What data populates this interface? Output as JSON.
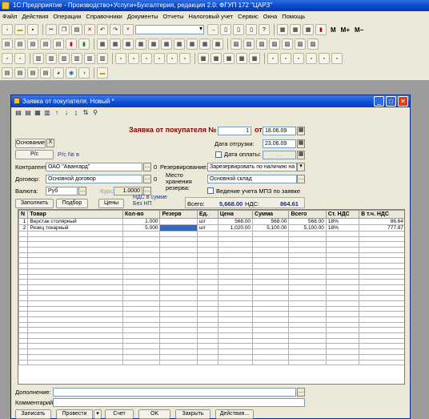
{
  "app": {
    "title": "1С:Предприятие - Производство+Услуги+Бухгалтерия, редакция 2.0: ФГУП 172 \"ЦАРЗ\""
  },
  "menu": [
    "Файл",
    "Действия",
    "Операции",
    "Справочники",
    "Документы",
    "Отчеты",
    "Налоговый учет",
    "Сервис",
    "Окна",
    "Помощь"
  ],
  "toolbar": {
    "m_label": "M",
    "mplus_label": "M+",
    "mminus_label": "M−"
  },
  "doc": {
    "window_title": "Заявка от покупателя. Новый *",
    "header_title": "Заявка от покупателя №",
    "number": "1",
    "from_label": "от",
    "date": "18.06.09",
    "basis_button": "Основание",
    "clear_mark": "X",
    "shipment_date_label": "Дата отгрузки:",
    "shipment_date": "23.06.09",
    "rs_button": "Р/с",
    "rs_text": "Р/с № в",
    "payment_date_label": "Дата оплаты:",
    "payment_date": ". .",
    "contractor_label": "Контрагент:",
    "contractor": "ОАО \"Авангард\"",
    "contractor_count": "0",
    "reservation_label": "Резервирование:",
    "reservation": "Зарезервировать по наличию на с",
    "contract_label": "Договор:",
    "contract": "Основной договор",
    "contract_count": "0",
    "storage_label": "Место хранения резерва:",
    "storage": "Основной склад",
    "currency_label": "Валюта:",
    "currency": "Руб",
    "rate_label": "Курс:",
    "rate": "1.0000",
    "mpz_label": "Ведение учета МПЗ по заявке"
  },
  "tabs_bar": {
    "fill_button": "Заполнить",
    "pick_button": "Подбор",
    "prices_button": "Цены",
    "vat_note": "НДС в сумме",
    "np_note": "Без НП",
    "total_label": "Всего:",
    "total_value": "5,668.00",
    "vat_label": "НДС:",
    "vat_value": "864.61"
  },
  "table": {
    "columns": [
      "N",
      "Товар",
      "Кол-во",
      "Резерв",
      "Ед.",
      "Цена",
      "Сумма",
      "Всего",
      "Ст. НДС",
      "В т.ч. НДС"
    ],
    "rows": [
      [
        "1",
        "Верстак столярный",
        "1.000",
        "",
        "шт",
        "568.00",
        "568.00",
        "568.00",
        "18%",
        "86.64"
      ],
      [
        "2",
        "Резец токарный",
        "5.000",
        "",
        "шт",
        "1,020.00",
        "5,100.00",
        "5,100.00",
        "18%",
        "777.97"
      ]
    ]
  },
  "footer": {
    "addition_label": "Дополнение:",
    "comment_label": "Комментарий:",
    "record_button": "Записать",
    "post_button": "Провести",
    "invoice_button": "Счет",
    "ok_button": "OK",
    "close_button": "Закрыть",
    "actions_button": "Действия..."
  }
}
